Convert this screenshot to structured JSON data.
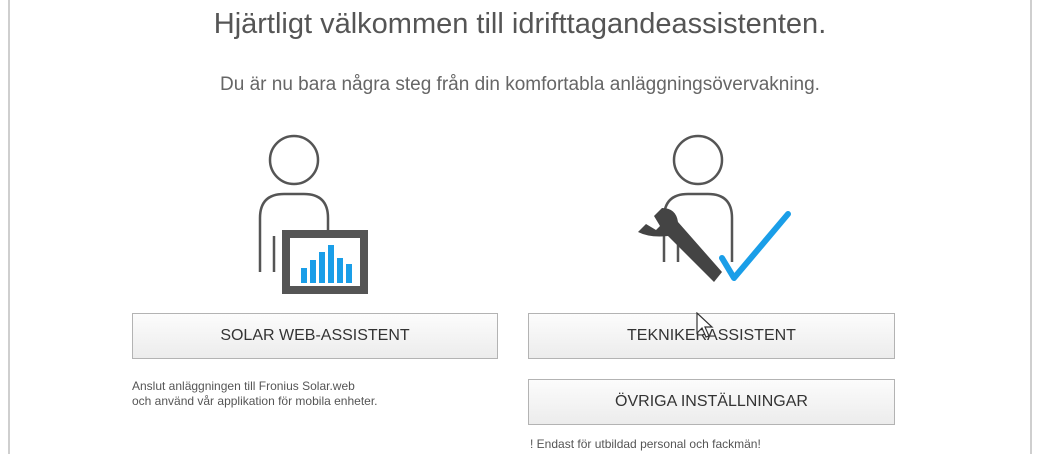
{
  "header": {
    "title": "Hjärtligt välkommen till idrifttagandeassistenten.",
    "subtitle": "Du är nu bara några steg från din komfortabla anläggningsövervakning."
  },
  "left": {
    "illustration": "user-with-monitoring-chart-icon",
    "button_label": "SOLAR WEB-ASSISTENT",
    "description_line1": "Anslut anläggningen till Fronius Solar.web",
    "description_line2": "och använd vår applikation för mobila enheter."
  },
  "right": {
    "illustration": "technician-with-wrench-and-checkmark-icon",
    "button_label": "TEKNIKERASSISTENT",
    "other_button_label": "ÖVRIGA INSTÄLLNINGAR",
    "note": "! Endast för utbildad personal och fackmän!"
  },
  "colors": {
    "accent_blue": "#1a9ee8",
    "icon_gray": "#555555",
    "text_gray": "#555555"
  }
}
